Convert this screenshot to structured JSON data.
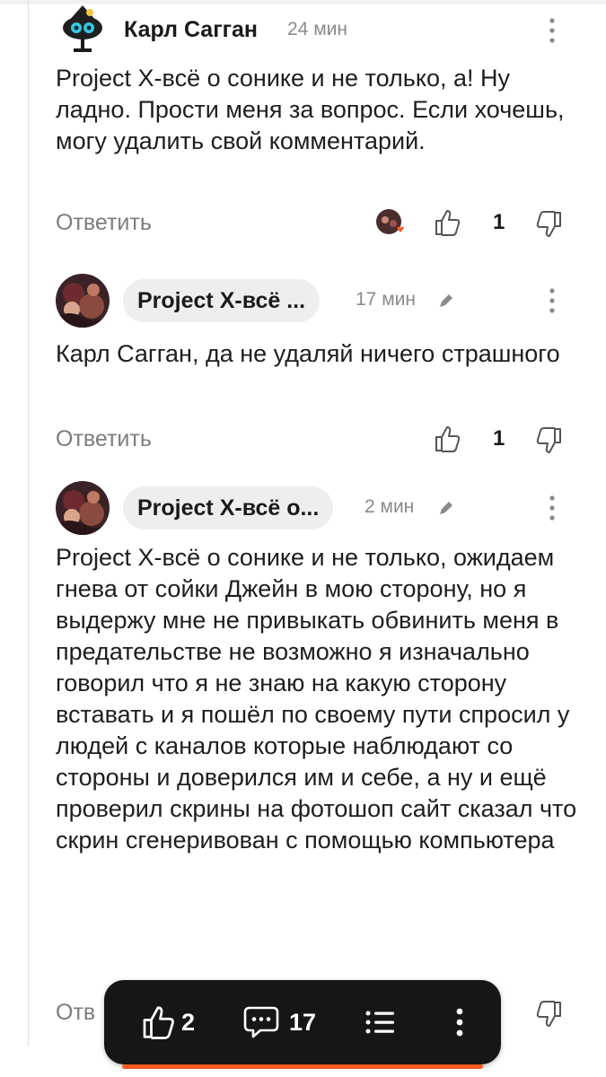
{
  "comments": [
    {
      "author": "Карл Сагган",
      "time": "24 мин",
      "text": "Project X-всё о сонике и не только, а! Ну ладно. Прости меня за вопрос. Если хочешь, могу удалить свой комментарий.",
      "reply_label": "Ответить",
      "likes": "1"
    },
    {
      "author": "Project X-всё ...",
      "time": "17 мин",
      "text": "Карл Сагган, да не удаляй ничего страшного",
      "reply_label": "Ответить",
      "likes": "1"
    },
    {
      "author": "Project X-всё о...",
      "time": "2 мин",
      "text": "Project X-всё о сонике и не только, ожидаем гнева от сойки Джейн в мою сторону, но я выдержу мне не привыкать обвинить меня в предательстве не возможно я изначально говорил что я не знаю на какую сторону вставать и я пошёл по своему пути спросил у людей с каналов которые наблюдают со стороны и доверился им и себе, а ну и ещё проверил скрины на фотошоп сайт сказал что скрин сгенеривован с помощью компьютера",
      "reply_label": "Отв"
    }
  ],
  "bottom_bar": {
    "likes": "2",
    "comments": "17"
  },
  "icons": {
    "like": "thumbs-up-icon",
    "dislike": "thumbs-down-icon",
    "menu": "more-vertical-icon",
    "edit": "pencil-icon",
    "comments": "comment-bubble-icon",
    "contents": "list-icon"
  },
  "colors": {
    "accent": "#ff5a1f",
    "bar": "#161616",
    "muted": "#7d7d7d"
  }
}
